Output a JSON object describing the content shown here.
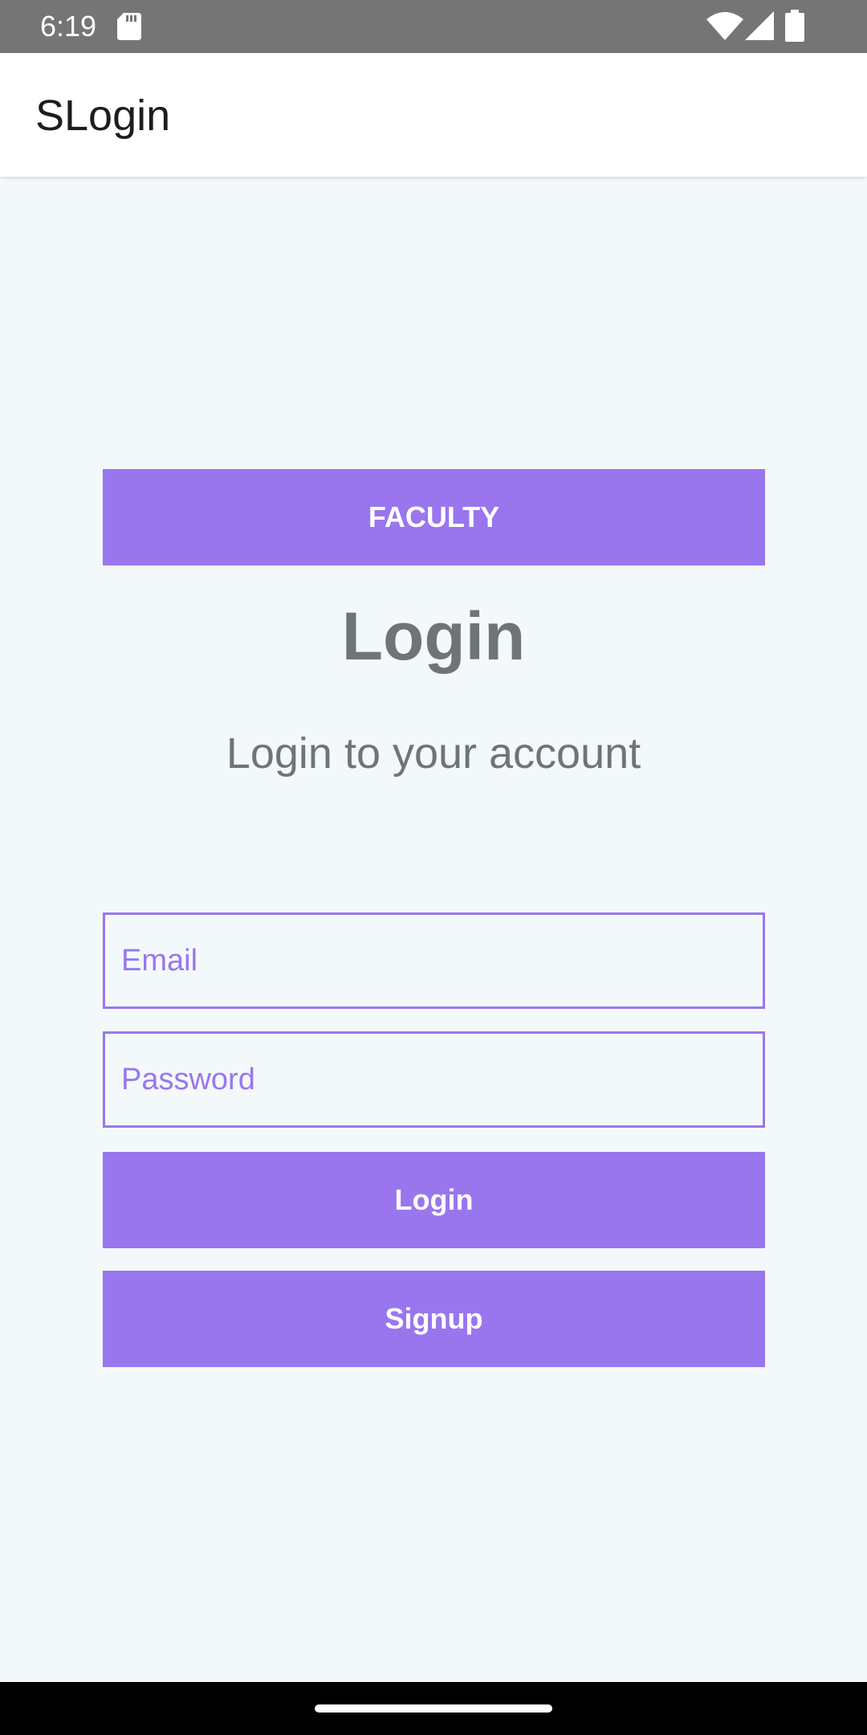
{
  "status_bar": {
    "time": "6:19",
    "background_color": "#757575",
    "icons": [
      "sd-card-icon",
      "wifi-icon",
      "signal-icon",
      "battery-icon"
    ]
  },
  "app_bar": {
    "title": "SLogin"
  },
  "main": {
    "role_button_label": "FACULTY",
    "heading": "Login",
    "subtitle": "Login to your account",
    "email": {
      "value": "",
      "placeholder": "Email"
    },
    "password": {
      "value": "",
      "placeholder": "Password"
    },
    "login_button_label": "Login",
    "signup_button_label": "Signup"
  },
  "colors": {
    "accent": "#9a76ee",
    "background": "#f3f9fb",
    "heading_text": "#6f7478",
    "app_bar": "#ffffff"
  }
}
